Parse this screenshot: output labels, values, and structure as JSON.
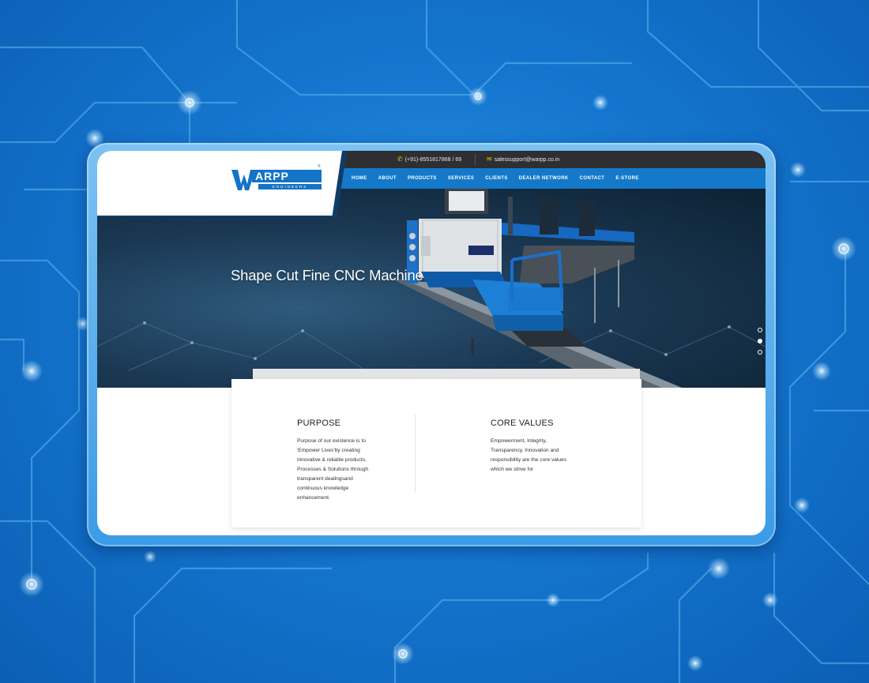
{
  "topbar": {
    "phone": "(+91)-8551817868 / 69",
    "email": "salessupport@warpp.co.in",
    "phone_icon": "phone-icon",
    "email_icon": "envelope-icon"
  },
  "logo": {
    "name": "ARPP",
    "sub": "ENGINEERS",
    "registered": "®"
  },
  "nav": {
    "items": [
      "HOME",
      "ABOUT",
      "PRODUCTS",
      "SERVICES",
      "CLIENTS",
      "DEALER NETWORK",
      "CONTACT",
      "E-STORE"
    ]
  },
  "hero": {
    "title": "Shape Cut Fine CNC Machine",
    "slides": 3,
    "active_slide": 2
  },
  "purpose": {
    "title": "PURPOSE",
    "lines": [
      "Purpose of our existence is to",
      "'Empower Lives'by creating",
      "innovative & reliable products,",
      "Processes & Solutions through",
      "transparent dealingsand",
      "continuous knowledge",
      "enhancement."
    ]
  },
  "core_values": {
    "title": "CORE VALUES",
    "lines": [
      "Empowerment, Integrity,",
      "Transparency, Innovation and",
      "responsibility are the core values",
      "which we strive for"
    ]
  },
  "colors": {
    "brand_blue": "#1479c9",
    "topbar": "#2d2f33",
    "icon_accent": "#f2c200"
  }
}
